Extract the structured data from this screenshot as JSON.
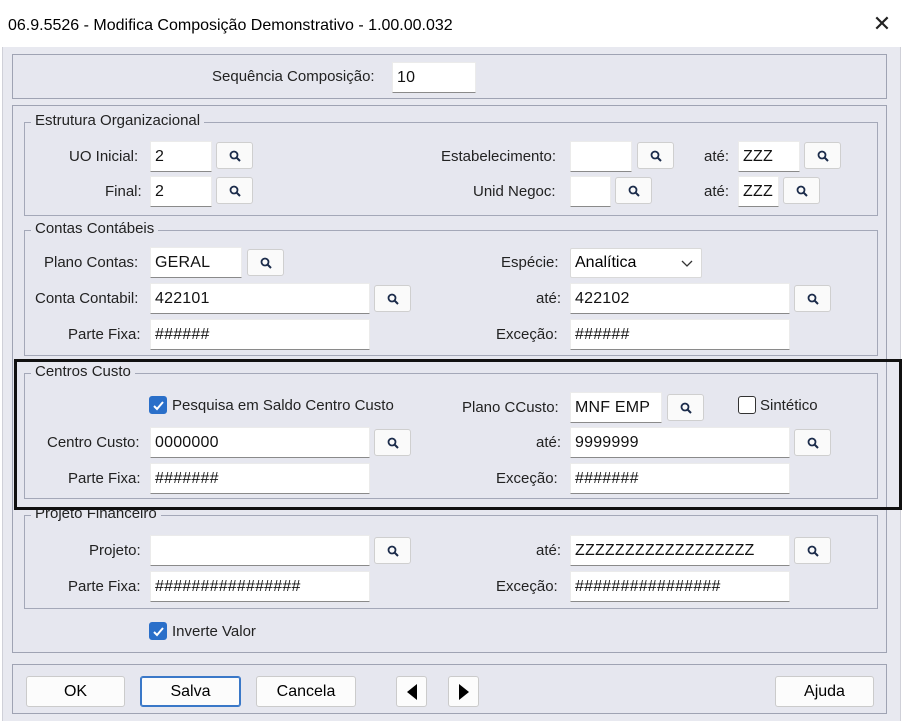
{
  "window": {
    "title": "06.9.5526 - Modifica Composição Demonstrativo - 1.00.00.032",
    "close_glyph": "✕"
  },
  "sequencia": {
    "label": "Sequência Composição:",
    "value": "10"
  },
  "estrutura": {
    "legend": "Estrutura Organizacional",
    "uo_inicial_label": "UO Inicial:",
    "uo_inicial_value": "2",
    "final_label": "Final:",
    "final_value": "2",
    "estab_label": "Estabelecimento:",
    "estab_value": "",
    "estab_ate_label": "até:",
    "estab_ate_value": "ZZZ",
    "unid_label": "Unid Negoc:",
    "unid_value": "",
    "unid_ate_label": "até:",
    "unid_ate_value": "ZZZ"
  },
  "contas": {
    "legend": "Contas Contábeis",
    "plano_label": "Plano Contas:",
    "plano_value": "GERAL",
    "especie_label": "Espécie:",
    "especie_value": "Analítica",
    "conta_label": "Conta Contabil:",
    "conta_value": "422101",
    "conta_ate_label": "até:",
    "conta_ate_value": "422102",
    "parte_label": "Parte Fixa:",
    "parte_value": "######",
    "excecao_label": "Exceção:",
    "excecao_value": "######"
  },
  "centros": {
    "legend": "Centros Custo",
    "pesquisa_label": "Pesquisa em Saldo Centro Custo",
    "pesquisa_checked": true,
    "plano_label": "Plano CCusto:",
    "plano_value": "MNF EMP",
    "sintetico_label": "Sintético",
    "sintetico_checked": false,
    "centro_label": "Centro Custo:",
    "centro_value": "0000000",
    "centro_ate_label": "até:",
    "centro_ate_value": "9999999",
    "parte_label": "Parte Fixa:",
    "parte_value": "#######",
    "excecao_label": "Exceção:",
    "excecao_value": "#######"
  },
  "projeto": {
    "legend": "Projeto Financeiro",
    "projeto_label": "Projeto:",
    "projeto_value": "",
    "projeto_ate_label": "até:",
    "projeto_ate_value": "ZZZZZZZZZZZZZZZZZZ",
    "parte_label": "Parte Fixa:",
    "parte_value": "################",
    "excecao_label": "Exceção:",
    "excecao_value": "################"
  },
  "inverte": {
    "label": "Inverte Valor",
    "checked": true
  },
  "buttons": {
    "ok": "OK",
    "salva": "Salva",
    "cancela": "Cancela",
    "ajuda": "Ajuda"
  },
  "colors": {
    "accent": "#2a6fc9",
    "panel_bg": "#e6e7ef",
    "highlight_border": "#111111"
  }
}
